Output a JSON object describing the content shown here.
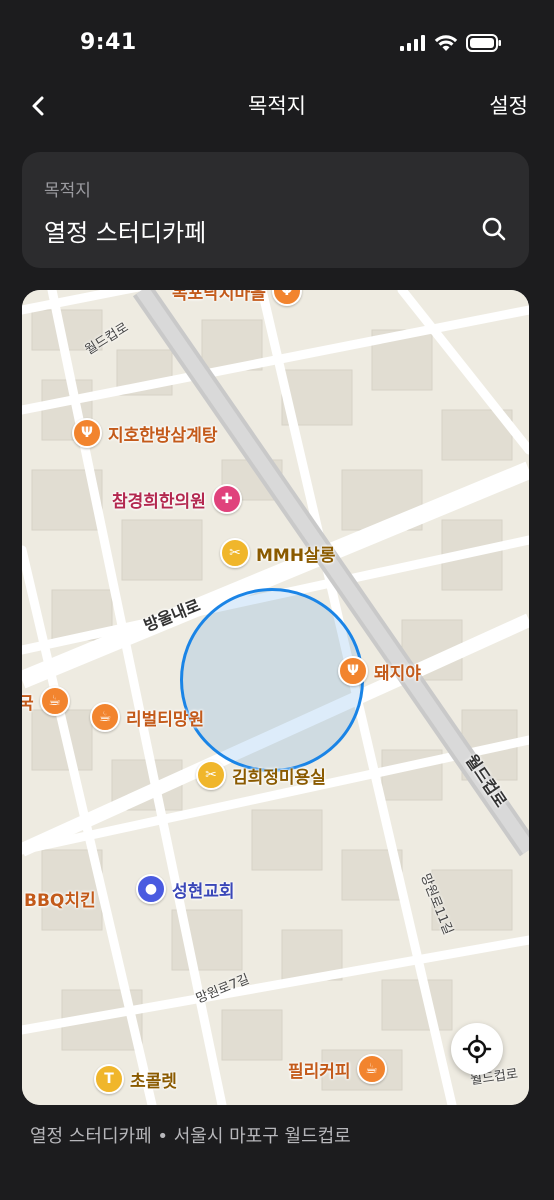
{
  "status": {
    "time": "9:41"
  },
  "nav": {
    "back_icon": "chevron-left-icon",
    "title": "목적지",
    "settings_label": "설정"
  },
  "search": {
    "label": "목적지",
    "value": "열정 스터디카페",
    "icon": "search-icon"
  },
  "map": {
    "pois": [
      {
        "name": "지호한방삼계탕",
        "icon": "restaurant-icon"
      },
      {
        "name": "참경희한의원",
        "icon": "medical-icon"
      },
      {
        "name": "MMH살롱",
        "icon": "salon-icon"
      },
      {
        "name": "돼지야",
        "icon": "restaurant-icon"
      },
      {
        "name": "리벌티망원",
        "icon": "cafe-icon"
      },
      {
        "name": "김희정미용실",
        "icon": "salon-icon"
      },
      {
        "name": "성현교회",
        "icon": "church-icon"
      },
      {
        "name": "필리커피",
        "icon": "cafe-icon"
      },
      {
        "name": "초콜렛",
        "icon": "clothing-icon"
      },
      {
        "name": "BBQ치킨",
        "icon": "restaurant-icon"
      },
      {
        "name": "국",
        "icon": "cafe-icon"
      },
      {
        "name": "목포낙지마을",
        "icon": "restaurant-icon"
      }
    ],
    "roads": {
      "bangul": "방울내로",
      "worldcup_main": "월드컵로",
      "worldcup_top": "월드컵로",
      "worldcup_bottom": "월드컵로",
      "mangwon11": "망원로11길",
      "mangwon7": "망원로7길"
    },
    "locate_icon": "crosshair-icon"
  },
  "footer": {
    "text": "열정 스터디카페 • 서울시 마포구 월드컵로"
  }
}
